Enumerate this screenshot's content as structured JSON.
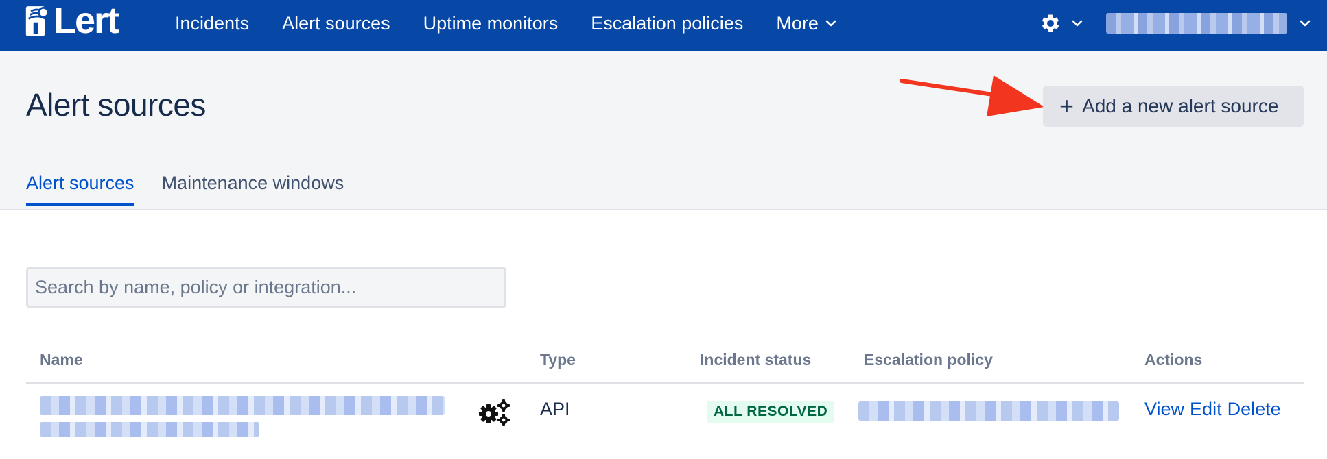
{
  "app": {
    "logo_text": "Lert"
  },
  "nav": {
    "items": [
      {
        "label": "Incidents"
      },
      {
        "label": "Alert sources"
      },
      {
        "label": "Uptime monitors"
      },
      {
        "label": "Escalation policies"
      },
      {
        "label": "More"
      }
    ]
  },
  "header": {
    "title": "Alert sources",
    "add_button_label": "Add a new alert source",
    "add_button_icon": "plus-icon"
  },
  "tabs": [
    {
      "label": "Alert sources",
      "active": true
    },
    {
      "label": "Maintenance windows",
      "active": false
    }
  ],
  "search": {
    "placeholder": "Search by name, policy or integration..."
  },
  "table": {
    "columns": [
      "Name",
      "Type",
      "Incident status",
      "Escalation policy",
      "Actions"
    ],
    "rows": [
      {
        "type": "API",
        "incident_status": "ALL RESOLVED",
        "actions": [
          "View",
          "Edit",
          "Delete"
        ]
      }
    ]
  },
  "colors": {
    "nav_bg": "#0747a6",
    "accent": "#0052cc",
    "header_bg": "#f4f5f7",
    "status_resolved_bg": "#e3fcef",
    "status_resolved_text": "#006644",
    "annotation_arrow": "#f2351e"
  }
}
